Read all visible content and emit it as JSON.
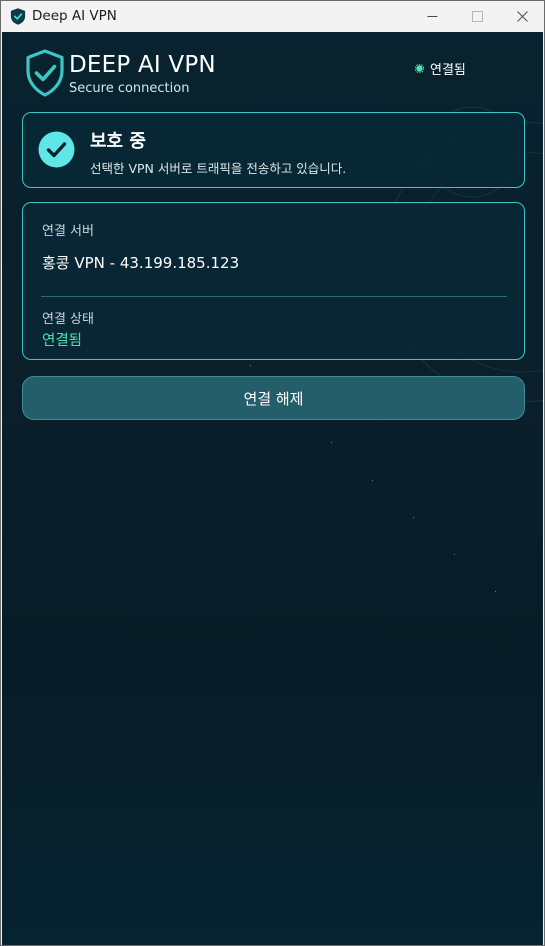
{
  "window": {
    "title": "Deep AI VPN"
  },
  "brand": {
    "name": "DEEP AI VPN",
    "tagline": "Secure connection",
    "accent_color": "#3cc6c6"
  },
  "header": {
    "status_text": "연결됨",
    "status_color": "#49e3b0"
  },
  "protection": {
    "title": "보호 중",
    "description": "선택한 VPN 서버로 트래픽을 전송하고 있습니다."
  },
  "connection": {
    "server_label": "연결 서버",
    "server_value": "홍콩 VPN - 43.199.185.123",
    "state_label": "연결 상태",
    "state_value": "연결됨",
    "state_color": "#49e3b0"
  },
  "actions": {
    "disconnect_label": "연결 해제"
  }
}
